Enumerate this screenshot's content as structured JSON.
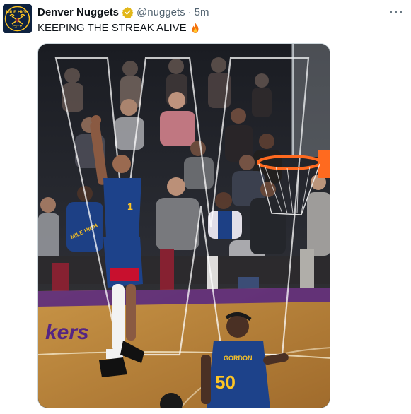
{
  "tweet": {
    "author_name": "Denver Nuggets",
    "handle": "@nuggets",
    "separator": "·",
    "time": "5m",
    "text": "KEEPING THE STREAK ALIVE",
    "more_label": "···"
  },
  "avatar": {
    "logo_top": "MILE HIGH",
    "logo_bottom": "CITY",
    "colors": {
      "navy": "#0e2240",
      "gold": "#fec524",
      "red": "#8b2131",
      "blue": "#1d428a"
    }
  },
  "media": {
    "floor_text_left": "kers",
    "crowd_jersey_1": "MILE HIGH",
    "player_number": "50",
    "player_name": "GORDON",
    "jersey_number_small": "1",
    "colors": {
      "jersey_blue": "#1d428a",
      "gold": "#fec524",
      "court": "#d9a441",
      "court_dark": "#8a5a1e",
      "lakers_purple": "#552583",
      "lakers_gold": "#fdb927",
      "rim_orange": "#ff6a1f"
    }
  },
  "icons": [
    "verified-badge-icon",
    "fire-emoji-icon",
    "more-options-icon"
  ]
}
